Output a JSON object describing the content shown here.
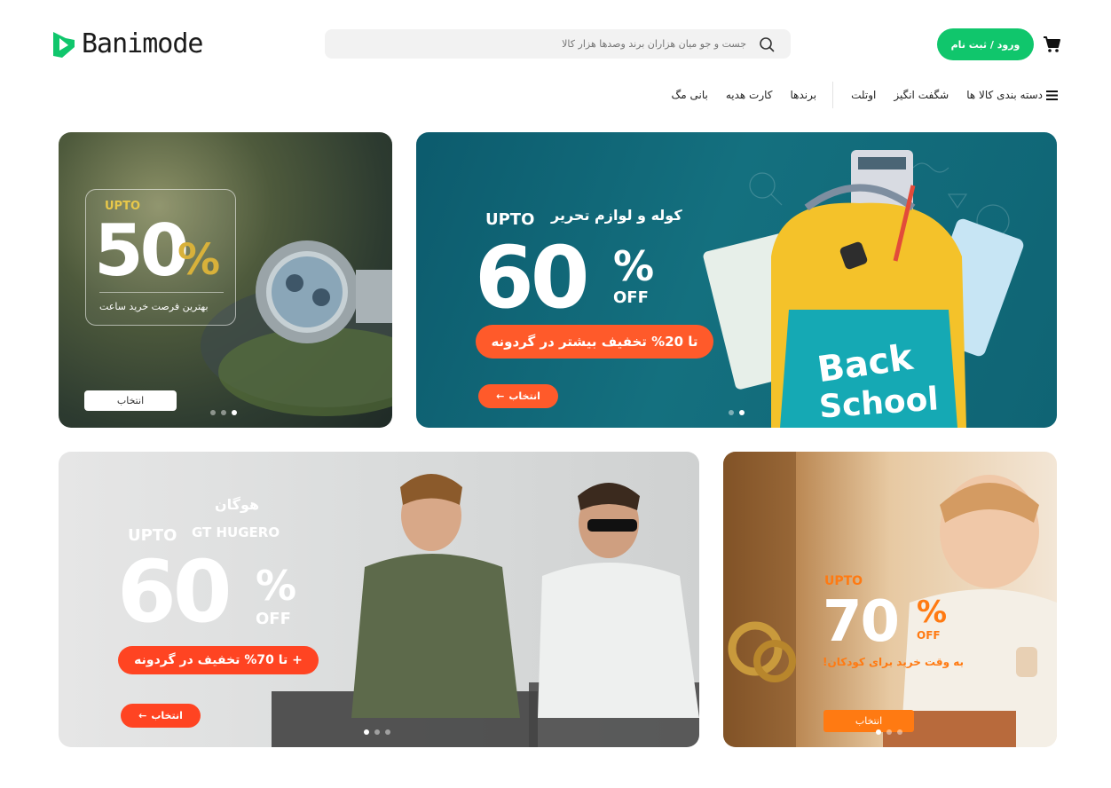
{
  "header": {
    "logo_text": "Banimode",
    "search_placeholder": "جست و جو میان هزاران برند وصدها هزار کالا",
    "login_label": "ورود / ثبت نام",
    "colors": {
      "brand": "#10c66c"
    }
  },
  "nav": {
    "items": [
      {
        "label": "دسته بندی کالا ها",
        "icon": "menu-icon"
      },
      {
        "label": "شگفت انگیز"
      },
      {
        "label": "اوتلت"
      },
      {
        "label": "برندها"
      },
      {
        "label": "کارت هدیه"
      },
      {
        "label": "بانی مگ"
      }
    ]
  },
  "banners": {
    "school": {
      "headline": "کوله و لوازم تحریر",
      "upto": "UPTO",
      "amount": "60",
      "percent": "%",
      "off": "OFF",
      "extra": "تا 20% تخفیف بیشتر در گردونه",
      "cta": "انتخاب",
      "art_text_1": "Back",
      "art_text_2": "School"
    },
    "watch": {
      "upto": "UPTO",
      "amount": "50",
      "percent": "%",
      "subtitle": "بهترین فرصت خرید ساعت",
      "cta": "انتخاب"
    },
    "fashion": {
      "brand_1": "هوگان",
      "brand_2": "GT HUGERO",
      "upto": "UPTO",
      "amount": "60",
      "percent": "%",
      "off": "OFF",
      "extra": "+ تا 70% تخفیف در گردونه",
      "cta": "انتخاب"
    },
    "kids": {
      "upto": "UPTO",
      "amount": "70",
      "percent": "%",
      "off": "OFF",
      "subtitle": "به وقت خرید برای کودکان!",
      "cta": "انتخاب"
    }
  }
}
